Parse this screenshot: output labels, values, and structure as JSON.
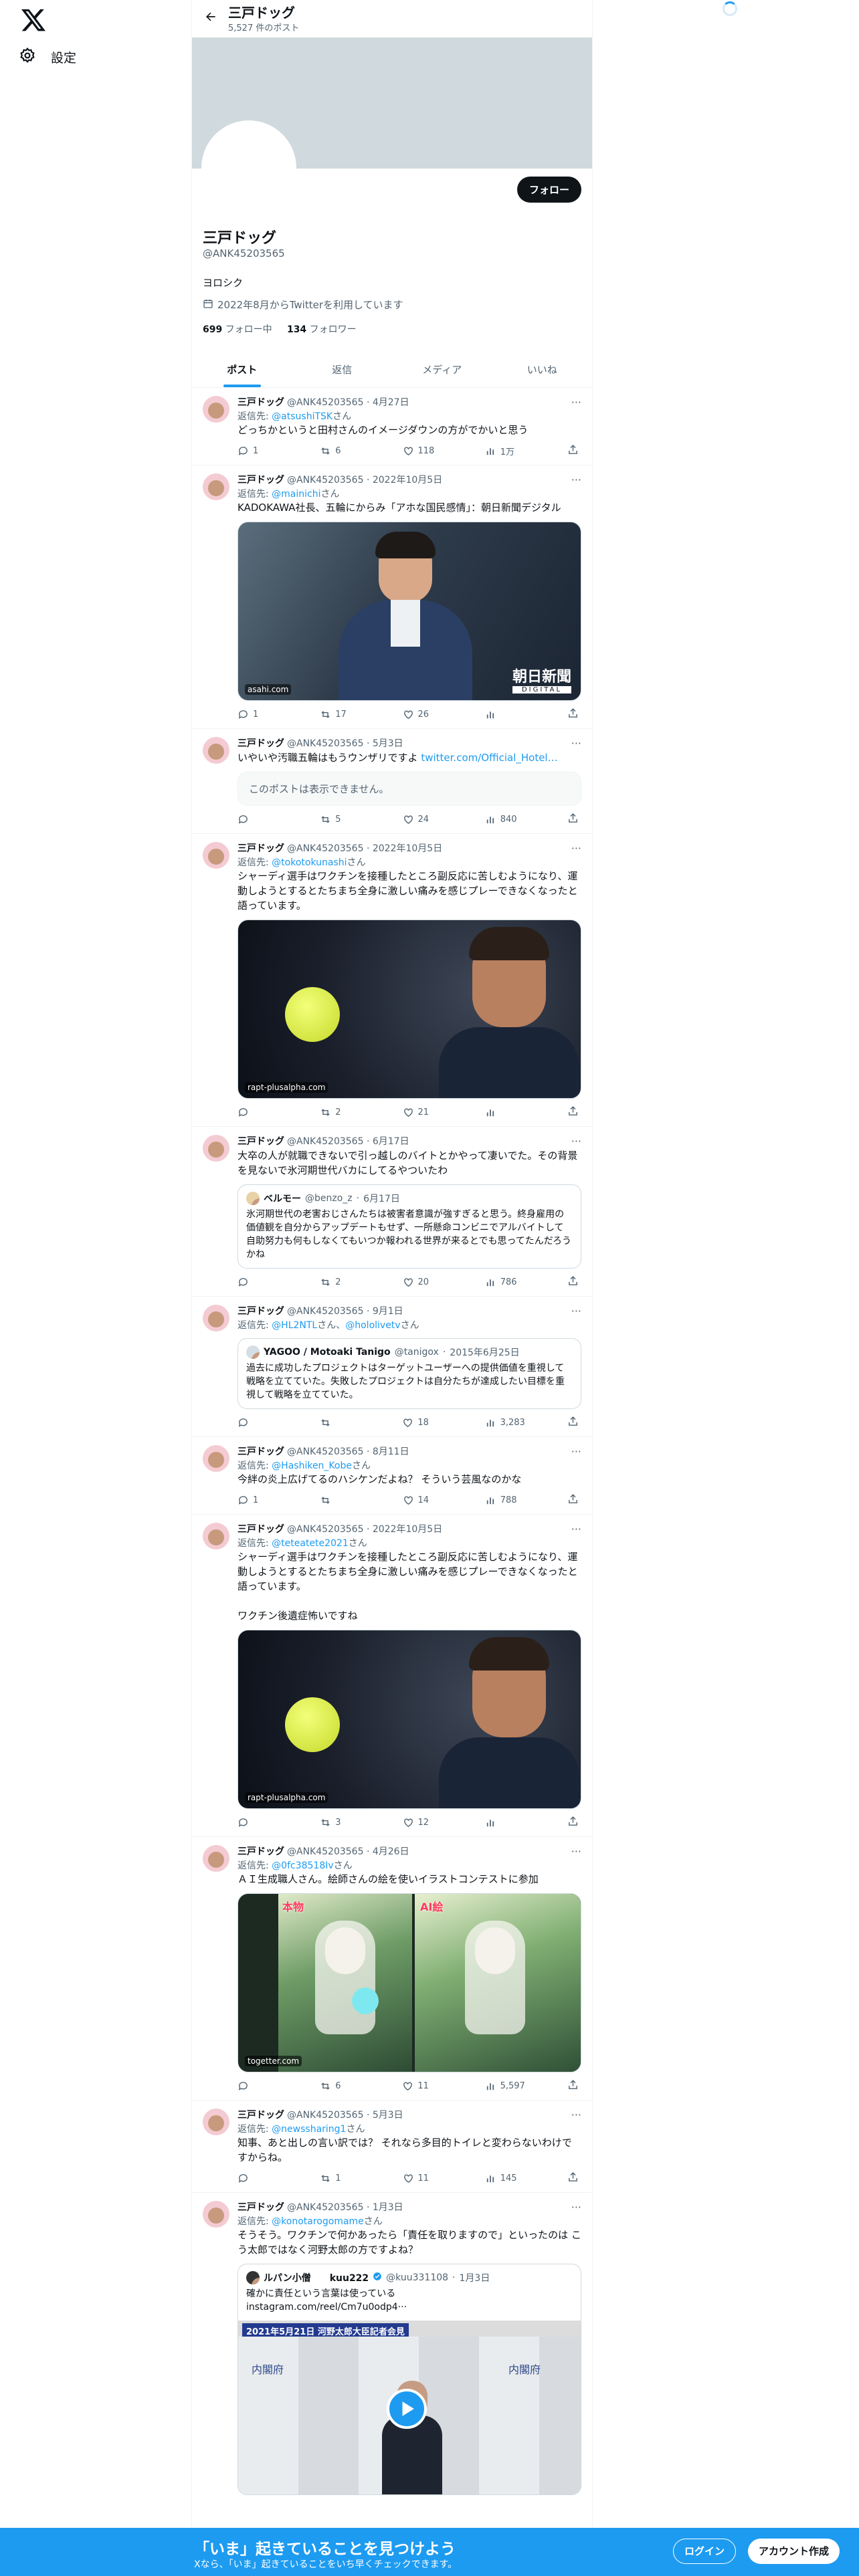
{
  "nav": {
    "settings_label": "設定"
  },
  "header": {
    "name": "三戸ドッグ",
    "post_count": "5,527 件のポスト"
  },
  "profile": {
    "follow_label": "フォロー",
    "name": "三戸ドッグ",
    "handle": "@ANK45203565",
    "bio": "ヨロシク",
    "joined": "2022年8月からTwitterを利用しています",
    "following_count": "699",
    "following_label": "フォロー中",
    "followers_count": "134",
    "followers_label": "フォロワー"
  },
  "tabs": [
    "ポスト",
    "返信",
    "メディア",
    "いいね"
  ],
  "tweets": [
    {
      "name": "三戸ドッグ",
      "handle": "@ANK45203565",
      "date": "4月27日",
      "reply_prefix": "返信先: ",
      "reply_to": "@atsushiTSK",
      "reply_suffix": "さん",
      "text": "どっちかというと田村さんのイメージダウンの方がでかいと思う",
      "replies": "1",
      "retweets": "6",
      "likes": "118",
      "views": "1万"
    },
    {
      "name": "三戸ドッグ",
      "handle": "@ANK45203565",
      "date": "2022年10月5日",
      "reply_prefix": "返信先: ",
      "reply_to": "@mainichi",
      "reply_suffix": "さん",
      "text": "KADOKAWA社長、五輪にからみ「アホな国民感情」：朝日新聞デジタル",
      "media_src": "asahi.com",
      "media_logo": "朝日新聞",
      "media_logo_sub": "DIGITAL",
      "replies": "1",
      "retweets": "17",
      "likes": "26",
      "views": ""
    },
    {
      "name": "三戸ドッグ",
      "handle": "@ANK45203565",
      "date": "5月3日",
      "text": "いやいや汚職五輪はもうウンザリですよ ",
      "link": "twitter.com/Official_Hotel…",
      "hidden": "このポストは表示できません。",
      "replies": "",
      "retweets": "5",
      "likes": "24",
      "views": "840"
    },
    {
      "name": "三戸ドッグ",
      "handle": "@ANK45203565",
      "date": "2022年10月5日",
      "reply_prefix": "返信先: ",
      "reply_to": "@tokotokunashi",
      "reply_suffix": "さん",
      "text": "シャーディ選手はワクチンを接種したところ副反応に苦しむようになり、運動しようとするとたちまち全身に激しい痛みを感じプレーできなくなったと語っています。",
      "media_src": "rapt-plusalpha.com",
      "replies": "",
      "retweets": "2",
      "likes": "21",
      "views": ""
    },
    {
      "name": "三戸ドッグ",
      "handle": "@ANK45203565",
      "date": "6月17日",
      "text": "大卒の人が就職できないで引っ越しのバイトとかやって凄いでた。その背景を見ないで氷河期世代バカにしてるやついたわ",
      "quote_name": "ベルモー",
      "quote_handle": "@benzo_z",
      "quote_date": "6月17日",
      "quote_text": "氷河期世代の老害おじさんたちは被害者意識が強すぎると思う。終身雇用の価値観を自分からアップデートもせず、一所懸命コンビニでアルバイトして自助努力も何もしなくてもいつか報われる世界が来るとでも思ってたんだろうかね",
      "replies": "",
      "retweets": "2",
      "likes": "20",
      "views": "786"
    },
    {
      "name": "三戸ドッグ",
      "handle": "@ANK45203565",
      "date": "9月1日",
      "reply_prefix": "返信先: ",
      "reply_to": "@HL2NTL",
      "reply_mid": "さん、",
      "reply_to2": "@hololivetv",
      "reply_suffix": "さん",
      "quote_name": "YAGOO / Motoaki Tanigo",
      "quote_handle": "@tanigox",
      "quote_date": "2015年6月25日",
      "quote_text": "過去に成功したプロジェクトはターゲットユーザーへの提供価値を重視して戦略を立てていた。失敗したプロジェクトは自分たちが達成したい目標を重視して戦略を立てていた。",
      "replies": "",
      "retweets": "",
      "likes": "18",
      "views": "3,283"
    },
    {
      "name": "三戸ドッグ",
      "handle": "@ANK45203565",
      "date": "8月11日",
      "reply_prefix": "返信先: ",
      "reply_to": "@Hashiken_Kobe",
      "reply_suffix": "さん",
      "text": "今絆の炎上広げてるのハシケンだよね？ そういう芸風なのかな",
      "replies": "1",
      "retweets": "",
      "likes": "14",
      "views": "788"
    },
    {
      "name": "三戸ドッグ",
      "handle": "@ANK45203565",
      "date": "2022年10月5日",
      "reply_prefix": "返信先: ",
      "reply_to": "@teteatete2021",
      "reply_suffix": "さん",
      "text": "シャーディ選手はワクチンを接種したところ副反応に苦しむようになり、運動しようとするとたちまち全身に激しい痛みを感じプレーできなくなったと語っています。\n\nワクチン後遺症怖いですね",
      "media_src": "rapt-plusalpha.com",
      "replies": "",
      "retweets": "3",
      "likes": "12",
      "views": ""
    },
    {
      "name": "三戸ドッグ",
      "handle": "@ANK45203565",
      "date": "4月26日",
      "reply_prefix": "返信先: ",
      "reply_to": "@0fc38518Iv",
      "reply_suffix": "さん",
      "text": "ＡＩ生成職人さん。絵師さんの絵を使いイラストコンテストに参加",
      "media_src": "togetter.com",
      "media_label_a": "本物",
      "media_label_b": "AI絵",
      "replies": "",
      "retweets": "6",
      "likes": "11",
      "views": "5,597"
    },
    {
      "name": "三戸ドッグ",
      "handle": "@ANK45203565",
      "date": "5月3日",
      "reply_prefix": "返信先: ",
      "reply_to": "@newssharing1",
      "reply_suffix": "さん",
      "text": "知事、あと出しの言い訳では？ それなら多目的トイレと変わらないわけですからね。",
      "replies": "",
      "retweets": "1",
      "likes": "11",
      "views": "145"
    },
    {
      "name": "三戸ドッグ",
      "handle": "@ANK45203565",
      "date": "1月3日",
      "reply_prefix": "返信先: ",
      "reply_to": "@konotarogomame",
      "reply_suffix": "さん",
      "text": "そうそう。ワクチンで何かあったら「責任を取りますので」といったのは こう太郎ではなく河野太郎の方ですよね？",
      "quote_name": "ルパン小僧　　kuu222",
      "quote_handle": "@kuu331108",
      "quote_date": "1月3日",
      "quote_text": "確かに責任という言葉は使っている\ninstagram.com/reel/Cm7u0odp4···",
      "video_caption": "2021年5月21日 河野太郎大臣記者会見",
      "video_wall": "内閣府"
    }
  ],
  "bottom_bar": {
    "title": "「いま」起きていることを見つけよう",
    "subtitle": "Xなら、「いま」起きていることをいち早くチェックできます。",
    "login": "ログイン",
    "signup": "アカウント作成"
  },
  "colors": {
    "accent": "#1d9bf0",
    "text": "#0f1419",
    "muted": "#536471",
    "banner": "#cfd9de"
  }
}
